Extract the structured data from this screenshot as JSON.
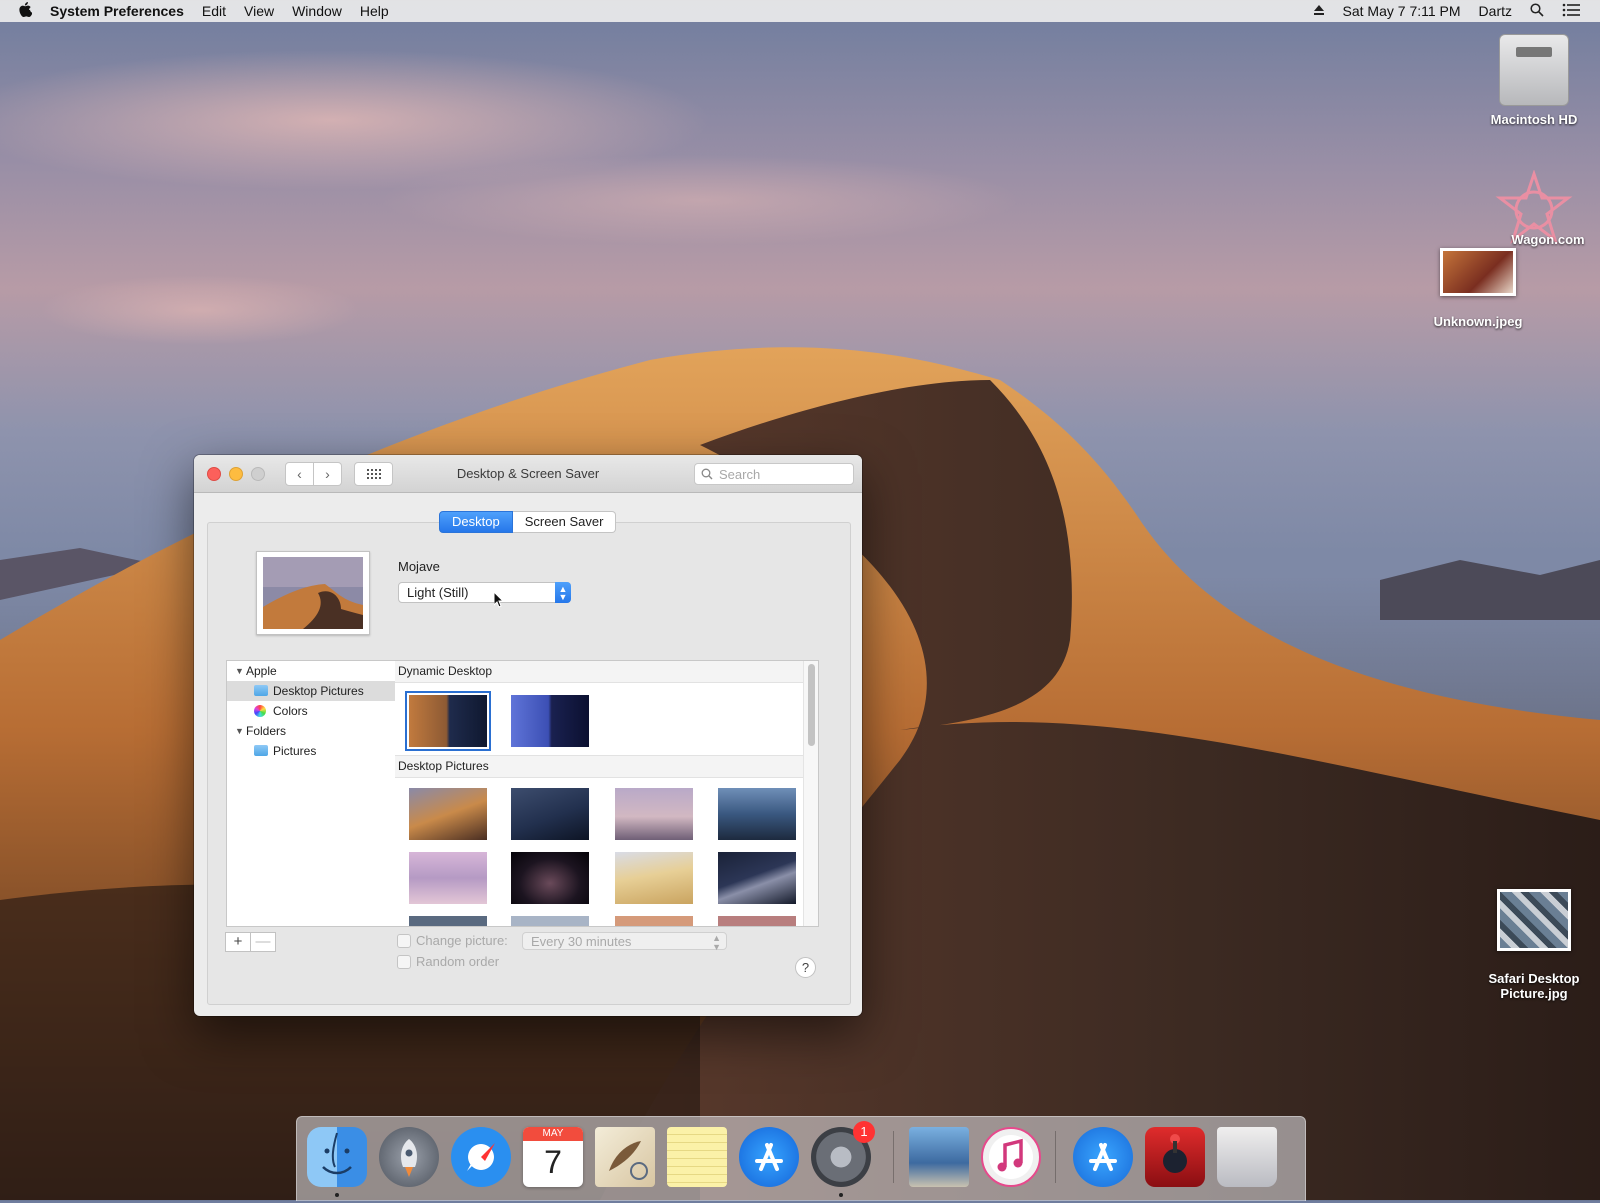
{
  "menubar": {
    "app_name": "System Preferences",
    "menus": [
      "Edit",
      "View",
      "Window",
      "Help"
    ],
    "datetime": "Sat May 7  7:11 PM",
    "user": "Dartz"
  },
  "desktop_icons": {
    "hd": "Macintosh HD",
    "wagon": "Wagon.com",
    "unknown": "Unknown.jpeg",
    "safari_pic_line1": "Safari Desktop",
    "safari_pic_line2": "Picture.jpg"
  },
  "window": {
    "title": "Desktop & Screen Saver",
    "search_placeholder": "Search",
    "tabs": {
      "desktop": "Desktop",
      "screensaver": "Screen Saver"
    },
    "wallpaper_name": "Mojave",
    "appearance_value": "Light (Still)",
    "sidebar": {
      "apple": "Apple",
      "desktop_pictures": "Desktop Pictures",
      "colors": "Colors",
      "folders": "Folders",
      "pictures": "Pictures"
    },
    "sections": {
      "dynamic": "Dynamic Desktop",
      "desktop_pictures": "Desktop Pictures"
    },
    "change_picture": "Change picture:",
    "interval": "Every 30 minutes",
    "random_order": "Random order",
    "add": "+",
    "remove": "—",
    "help": "?"
  },
  "dock": {
    "calendar_month": "MAY",
    "calendar_day": "7",
    "sysprefs_badge": "1"
  }
}
